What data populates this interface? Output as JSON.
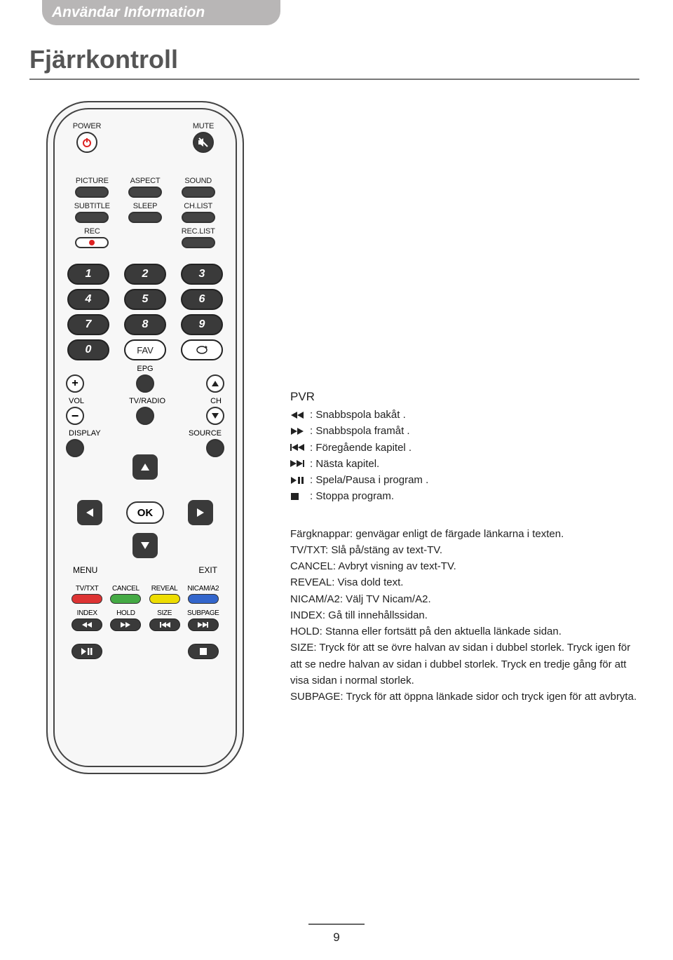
{
  "header": {
    "title": "Användar Information"
  },
  "page_title": "Fjärrkontroll",
  "remote": {
    "power": "POWER",
    "mute": "MUTE",
    "picture": "PICTURE",
    "aspect": "ASPECT",
    "sound": "SOUND",
    "subtitle": "SUBTITLE",
    "sleep": "SLEEP",
    "chlist": "CH.LIST",
    "rec": "REC",
    "reclist": "REC.LIST",
    "numbers": [
      "1",
      "2",
      "3",
      "4",
      "5",
      "6",
      "7",
      "8",
      "9",
      "0"
    ],
    "fav": "FAV",
    "epg": "EPG",
    "vol": "VOL",
    "tvradio": "TV/RADIO",
    "ch": "CH",
    "display": "DISPLAY",
    "source": "SOURCE",
    "ok": "OK",
    "menu": "MENU",
    "exit": "EXIT",
    "tvtxt": "TV/TXT",
    "cancel": "CANCEL",
    "reveal": "REVEAL",
    "nicam": "NICAM/A2",
    "index": "INDEX",
    "hold": "HOLD",
    "size": "SIZE",
    "subpage": "SUBPAGE"
  },
  "pvr": {
    "heading": "PVR",
    "items": [
      {
        "icon": "rewind",
        "text": ": Snabbspola bakåt ."
      },
      {
        "icon": "ffwd",
        "text": ": Snabbspola framåt ."
      },
      {
        "icon": "prev",
        "text": ": Föregående kapitel ."
      },
      {
        "icon": "next",
        "text": ": Nästa kapitel."
      },
      {
        "icon": "playpause",
        "text": ": Spela/Pausa i program ."
      },
      {
        "icon": "stop",
        "text": ": Stoppa program."
      }
    ]
  },
  "descriptions": [
    "Färgknappar: genvägar enligt de färgade länkarna i texten.",
    "TV/TXT: Slå på/stäng av text-TV.",
    "CANCEL: Avbryt visning av text-TV.",
    "REVEAL: Visa dold text.",
    "NICAM/A2: Välj TV Nicam/A2.",
    "INDEX: Gå till innehållssidan.",
    "HOLD: Stanna eller fortsätt på den aktuella länkade sidan.",
    "SIZE: Tryck för att se övre halvan av sidan i dubbel storlek. Tryck igen för att se nedre halvan av sidan i dubbel storlek. Tryck en tredje gång för att visa sidan i normal storlek.",
    "SUBPAGE: Tryck för att öppna länkade sidor och tryck igen för att avbryta."
  ],
  "page_number": "9"
}
